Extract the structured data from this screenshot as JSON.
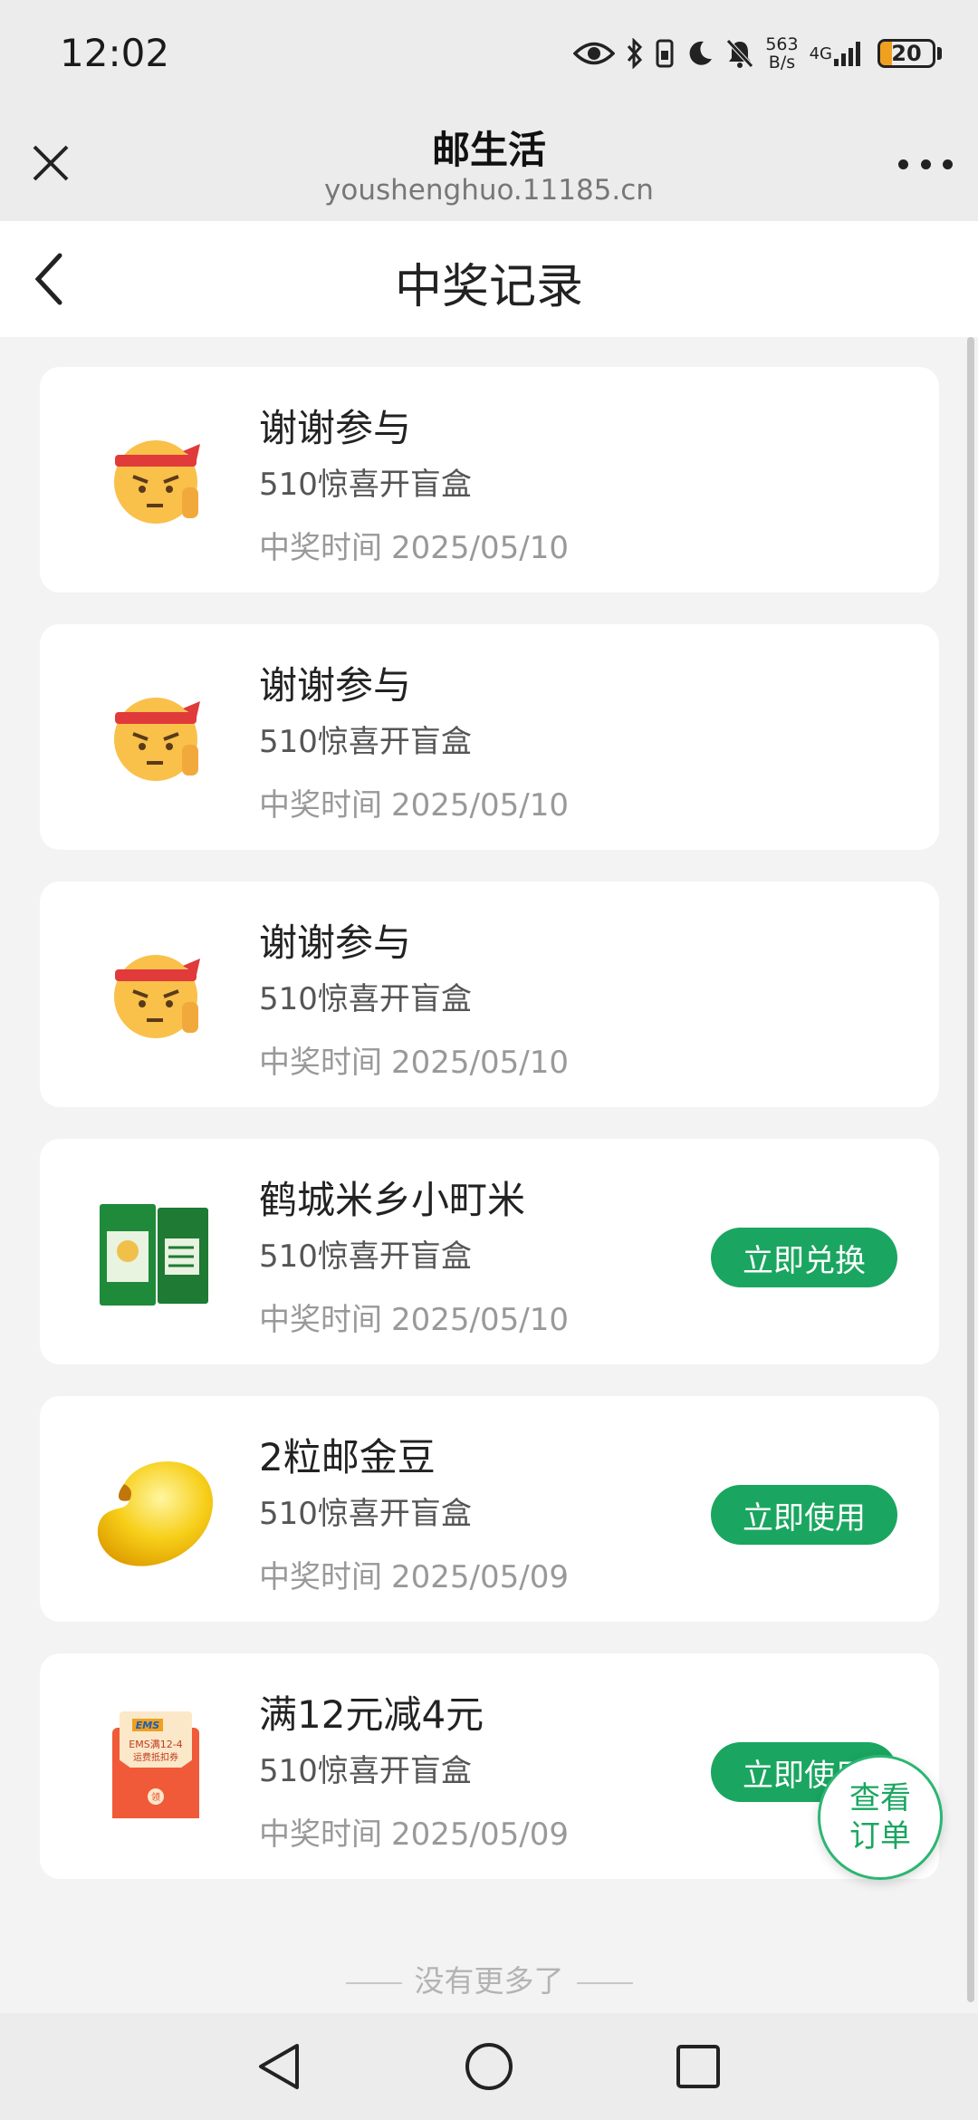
{
  "status_bar": {
    "time": "12:02",
    "speed_top": "563",
    "speed_bottom": "B/s",
    "network": "4G",
    "battery": "20",
    "icons": [
      "eye-icon",
      "bluetooth-icon",
      "vibrate-icon",
      "moon-icon",
      "mute-icon",
      "signal-icon",
      "battery-icon"
    ]
  },
  "browser": {
    "title": "邮生活",
    "url": "youshenghuo.11185.cn"
  },
  "page": {
    "title": "中奖记录"
  },
  "records": [
    {
      "title": "谢谢参与",
      "subtitle": "510惊喜开盲盒",
      "time_label": "中奖时间",
      "time": "2025/05/10",
      "image": "emoji-face-icon",
      "button": null
    },
    {
      "title": "谢谢参与",
      "subtitle": "510惊喜开盲盒",
      "time_label": "中奖时间",
      "time": "2025/05/10",
      "image": "emoji-face-icon",
      "button": null
    },
    {
      "title": "谢谢参与",
      "subtitle": "510惊喜开盲盒",
      "time_label": "中奖时间",
      "time": "2025/05/10",
      "image": "emoji-face-icon",
      "button": null
    },
    {
      "title": "鹤城米乡小町米",
      "subtitle": "510惊喜开盲盒",
      "time_label": "中奖时间",
      "time": "2025/05/10",
      "image": "rice-bag-image",
      "button": "立即兑换"
    },
    {
      "title": "2粒邮金豆",
      "subtitle": "510惊喜开盲盒",
      "time_label": "中奖时间",
      "time": "2025/05/09",
      "image": "gold-bean-image",
      "button": "立即使用"
    },
    {
      "title": "满12元减4元",
      "subtitle": "510惊喜开盲盒",
      "time_label": "中奖时间",
      "time": "2025/05/09",
      "image": "ems-coupon-image",
      "button": "立即使用",
      "coupon_text": {
        "brand": "EMS",
        "line1": "EMS满12-4",
        "line2": "运费抵扣券",
        "seal": "领"
      }
    }
  ],
  "footer": {
    "no_more": "没有更多了"
  },
  "fab": {
    "line1": "查看",
    "line2": "订单"
  },
  "colors": {
    "accent": "#1aa660",
    "background": "#f3f3f3"
  }
}
